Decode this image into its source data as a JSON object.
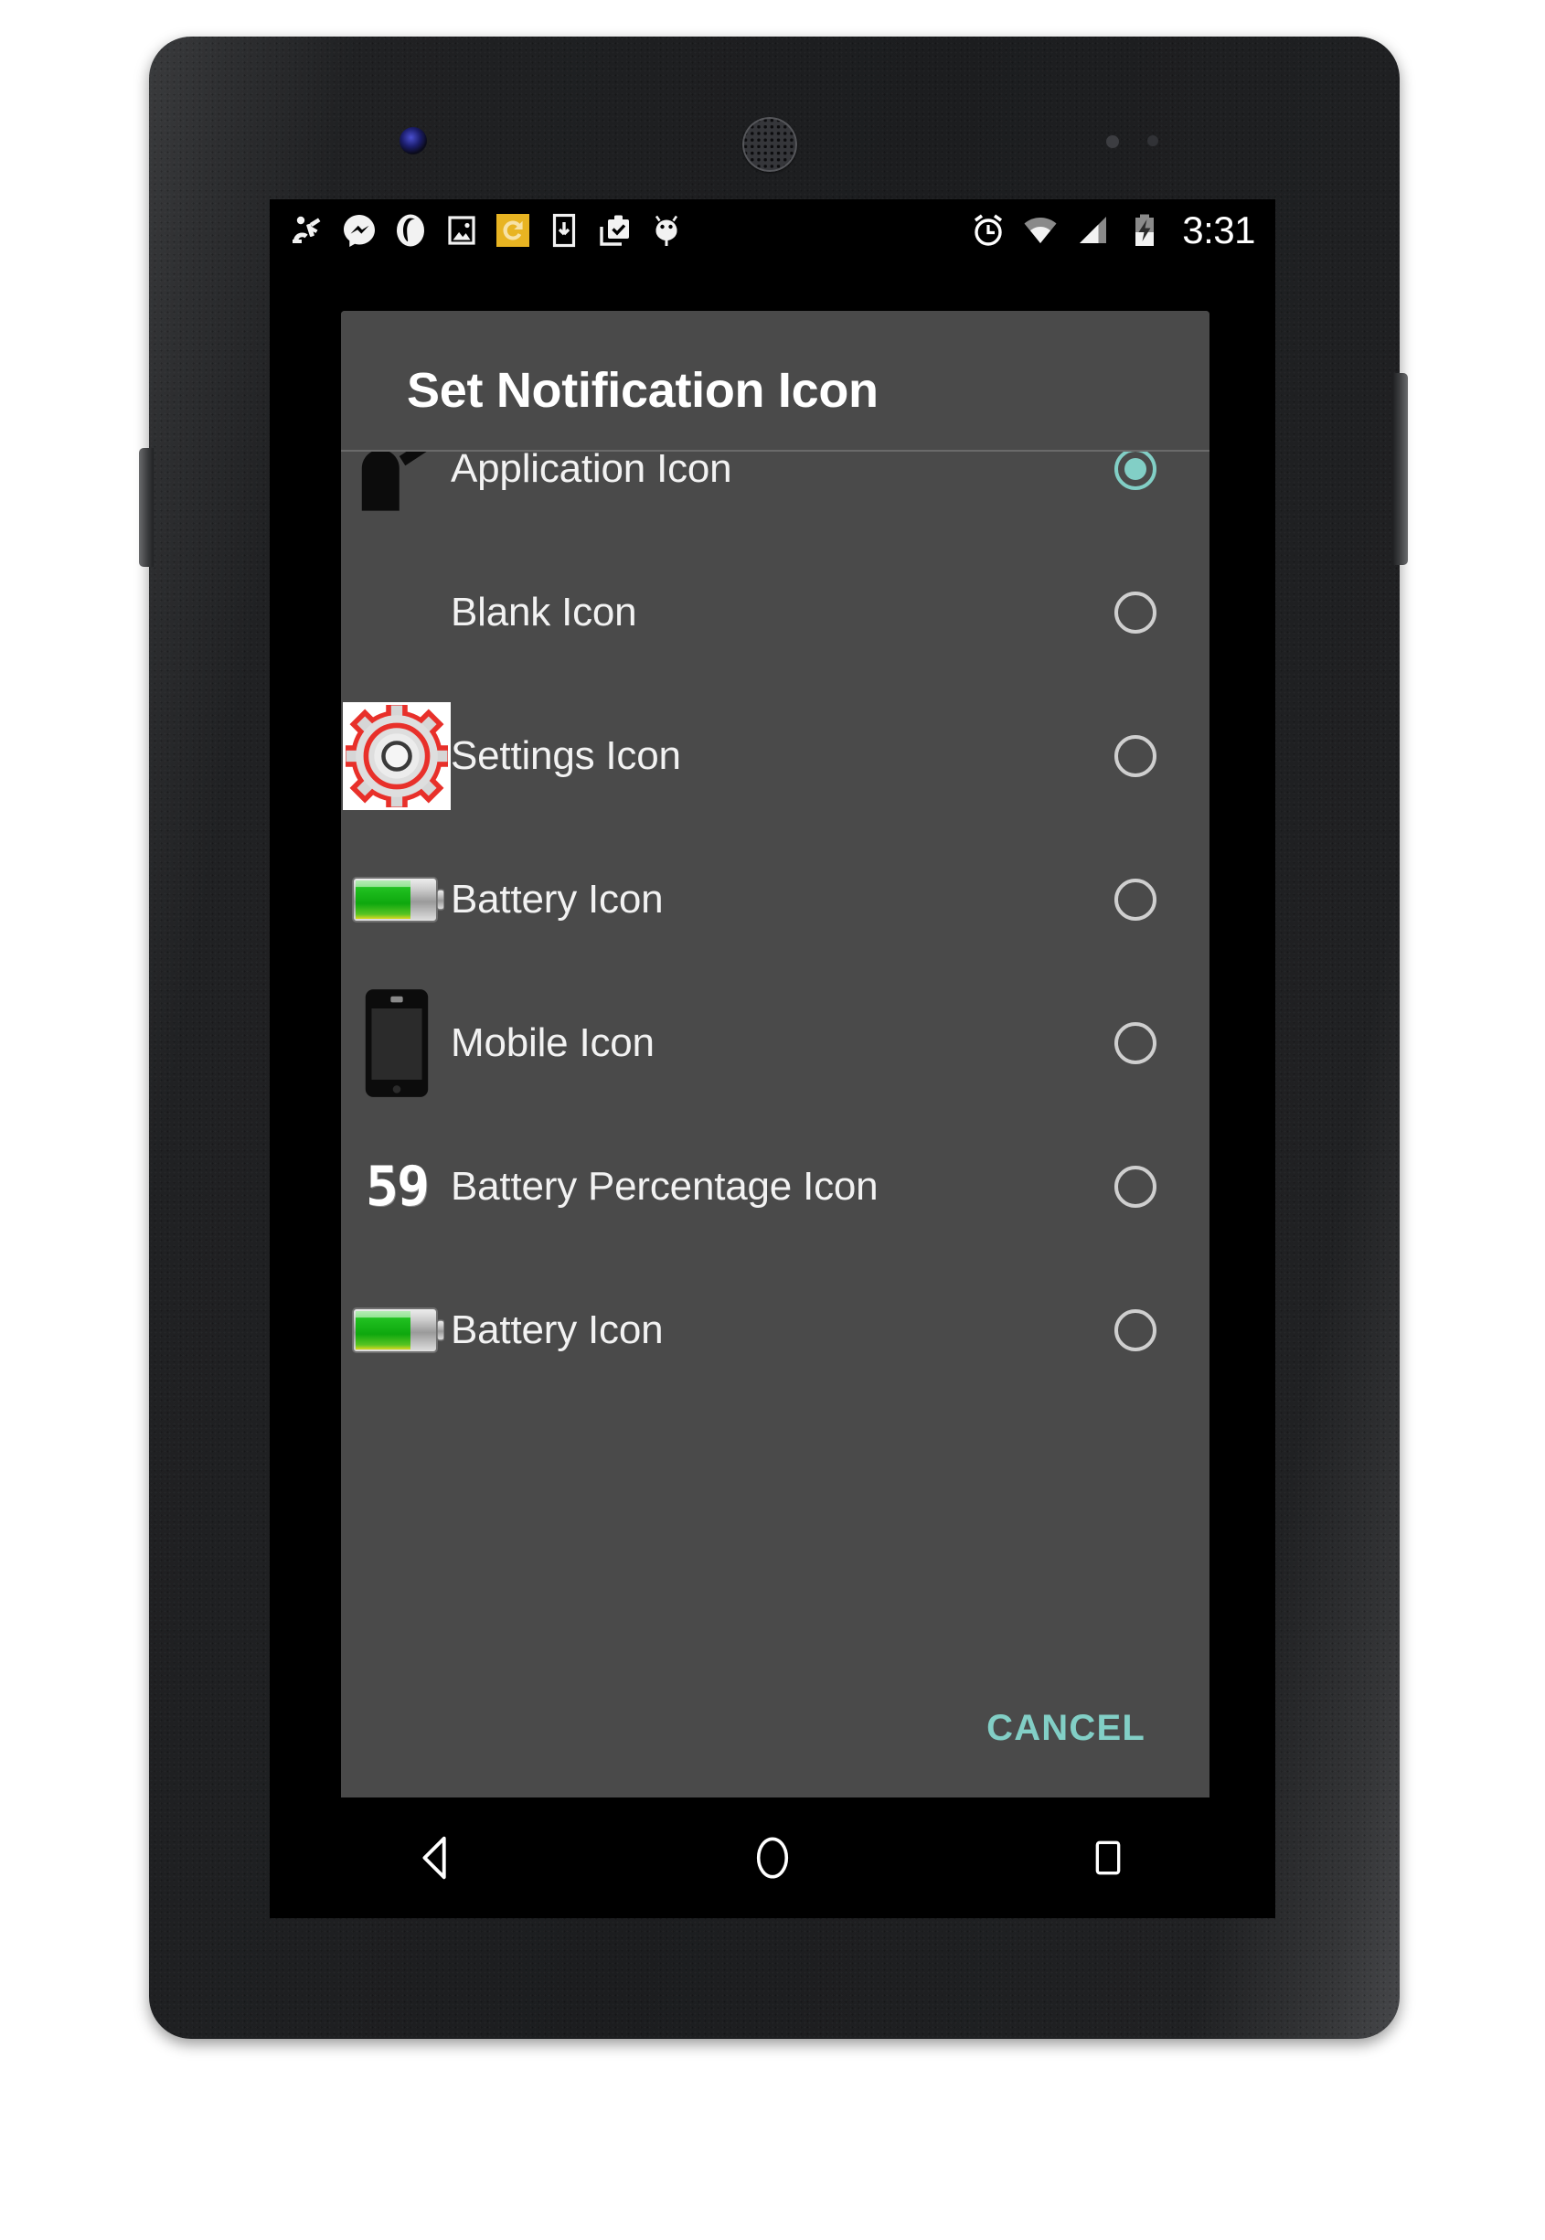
{
  "status_bar": {
    "time": "3:31",
    "notification_icons": [
      "android-dev-icon",
      "messenger-icon",
      "opera-icon",
      "photo-icon",
      "sync-icon",
      "download-to-device-icon",
      "clipboard-check-icon",
      "android-robot-icon"
    ],
    "system_icons": [
      "alarm-icon",
      "wifi-icon",
      "cellular-signal-icon",
      "battery-charging-icon"
    ]
  },
  "dialog": {
    "title": "Set Notification Icon",
    "items": [
      {
        "label": "Application Icon",
        "icon": "application-silhouette-icon",
        "selected": true
      },
      {
        "label": "Blank Icon",
        "icon": "blank-icon",
        "selected": false
      },
      {
        "label": "Settings Icon",
        "icon": "settings-gear-icon",
        "selected": false
      },
      {
        "label": "Battery Icon",
        "icon": "battery-green-icon",
        "selected": false
      },
      {
        "label": "Mobile Icon",
        "icon": "mobile-phone-icon",
        "selected": false
      },
      {
        "label": "Battery Percentage Icon",
        "icon": "battery-percentage-icon",
        "selected": false
      },
      {
        "label": "Battery Icon",
        "icon": "battery-green-icon",
        "selected": false
      }
    ],
    "battery_percentage_value": "59",
    "cancel_label": "CANCEL"
  },
  "nav_bar": {
    "back": "back-icon",
    "home": "home-icon",
    "recents": "recents-icon"
  },
  "colors": {
    "accent_teal": "#82cfc6",
    "dialog_background": "#4a4a4a",
    "status_bar_background": "#000000",
    "sync_icon_highlight": "#e8b422"
  }
}
